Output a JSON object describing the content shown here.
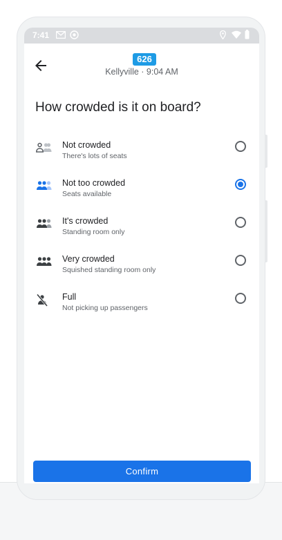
{
  "status_bar": {
    "time": "7:41",
    "icons": [
      "gmail-icon",
      "sync-icon",
      "location-icon",
      "wifi-icon",
      "battery-icon"
    ]
  },
  "header": {
    "back_icon": "arrow-left-icon",
    "route_number": "626",
    "subtitle": "Kellyville · 9:04 AM",
    "route_color": "#1e9be5"
  },
  "question": "How crowded is it on board?",
  "options": [
    {
      "title": "Not crowded",
      "subtitle": "There's lots of seats",
      "icon": "people-one-filled-icon",
      "selected": false
    },
    {
      "title": "Not too crowded",
      "subtitle": "Seats available",
      "icon": "people-two-filled-icon",
      "selected": true
    },
    {
      "title": "It's crowded",
      "subtitle": "Standing room only",
      "icon": "people-three-filled-icon",
      "selected": false
    },
    {
      "title": "Very crowded",
      "subtitle": "Squished standing room only",
      "icon": "people-all-filled-icon",
      "selected": false
    },
    {
      "title": "Full",
      "subtitle": "Not picking up passengers",
      "icon": "person-off-icon",
      "selected": false
    }
  ],
  "confirm_label": "Confirm",
  "accent_color": "#1a73e8"
}
